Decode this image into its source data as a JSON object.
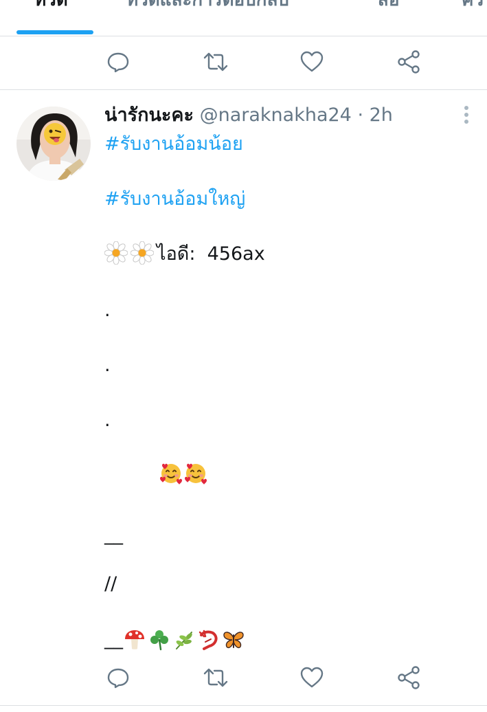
{
  "tabs": [
    {
      "label": "ทวีต",
      "active": true
    },
    {
      "label": "ทวีตและการตอบกลับ",
      "active": false
    },
    {
      "label": "สื่อ",
      "active": false
    },
    {
      "label": "ความ",
      "active": false
    }
  ],
  "colors": {
    "accent": "#1da1f2",
    "text_primary": "#14171a",
    "text_secondary": "#657786",
    "divider": "#dcdfe2"
  },
  "action_icons": [
    "reply-icon",
    "retweet-icon",
    "like-icon",
    "share-icon"
  ],
  "tweet": {
    "display_name": "น่ารักนะคะ",
    "handle": "@naraknakha24",
    "separator": "·",
    "time": "2h",
    "hashtag_1": "#รับงานอ้อมน้อย",
    "hashtag_2": "#รับงานอ้อมใหญ่",
    "id_label": "ไอดี:",
    "id_value": "456ax",
    "dot_1": ".",
    "dot_2": ".",
    "dot_3": ".",
    "dash_line_1": "__",
    "slash_line": "//",
    "dash_line_2": "__",
    "emojis_hearts": [
      "smiling-face-with-hearts",
      "smiling-face-with-hearts"
    ],
    "emojis_final": [
      "mushroom",
      "shamrock",
      "herb",
      "lobster",
      "butterfly"
    ]
  }
}
